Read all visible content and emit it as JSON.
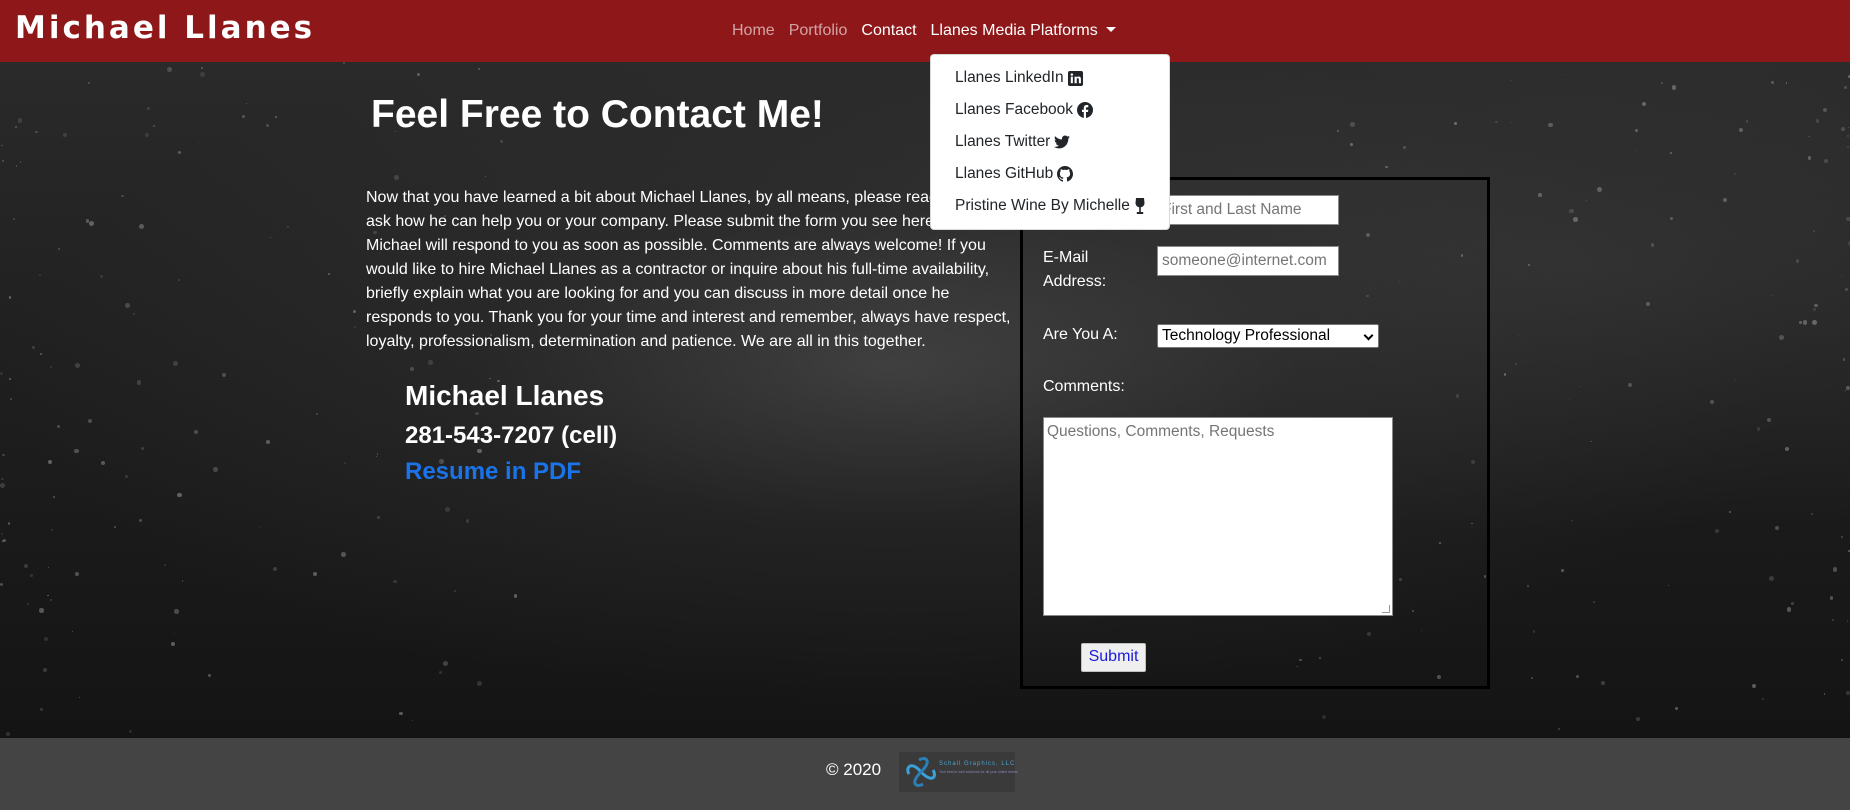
{
  "navbar": {
    "brand": "Michael Llanes",
    "links": [
      "Home",
      "Portfolio",
      "Contact"
    ],
    "dropdown_label": "Llanes Media Platforms",
    "dropdown_items": [
      {
        "label": "Llanes LinkedIn",
        "icon": "linkedin-icon"
      },
      {
        "label": "Llanes Facebook",
        "icon": "facebook-icon"
      },
      {
        "label": "Llanes Twitter",
        "icon": "twitter-icon"
      },
      {
        "label": "Llanes GitHub",
        "icon": "github-icon"
      },
      {
        "label": "Pristine Wine By Michelle",
        "icon": "wine-glass-icon"
      }
    ]
  },
  "main": {
    "title": "Feel Free to Contact Me!",
    "intro": "Now that you have learned a bit about Michael Llanes, by all means, please reach out and ask how he can help you or your company. Please submit the form you see here and Michael will respond to you as soon as possible. Comments are always welcome! If you would like to hire Michael Llanes as a contractor or inquire about his full-time availability, briefly explain what you are looking for and you can discuss in more detail once he responds to you. Thank you for your time and interest and remember, always have respect, loyalty, professionalism, determination and patience. We are all in this together.",
    "contact_name": "Michael Llanes",
    "contact_phone": "281-543-7207 (cell)",
    "resume_link": "Resume in PDF"
  },
  "form": {
    "name_placeholder": "First and Last Name",
    "email_label": "E-Mail Address:",
    "email_placeholder": "someone@internet.com",
    "type_label": "Are You A:",
    "type_selected": "Technology Professional",
    "comments_label": "Comments:",
    "comments_placeholder": "Questions, Comments, Requests",
    "submit_label": "Submit"
  },
  "footer": {
    "copyright": "© 2020",
    "logo_name": "Schall Graphics, LLC",
    "logo_tagline": "Your best in web solutions for all your online needs"
  },
  "colors": {
    "navbar": "#8e1719",
    "footer": "#444444",
    "link": "#1a73e8"
  }
}
